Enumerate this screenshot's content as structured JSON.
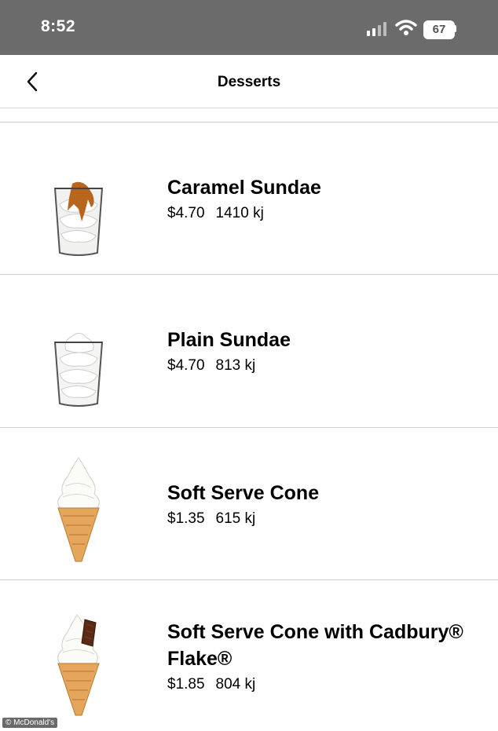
{
  "status_bar": {
    "time": "8:52",
    "battery": "67"
  },
  "header": {
    "title": "Desserts"
  },
  "items": [
    {
      "name": "Caramel Sundae",
      "price": "$4.70",
      "energy": "1410 kj"
    },
    {
      "name": "Plain Sundae",
      "price": "$4.70",
      "energy": "813 kj"
    },
    {
      "name": "Soft Serve Cone",
      "price": "$1.35",
      "energy": "615 kj"
    },
    {
      "name": "Soft Serve Cone with Cadbury® Flake®",
      "price": "$1.85",
      "energy": "804 kj"
    }
  ],
  "watermark": "© McDonald's"
}
